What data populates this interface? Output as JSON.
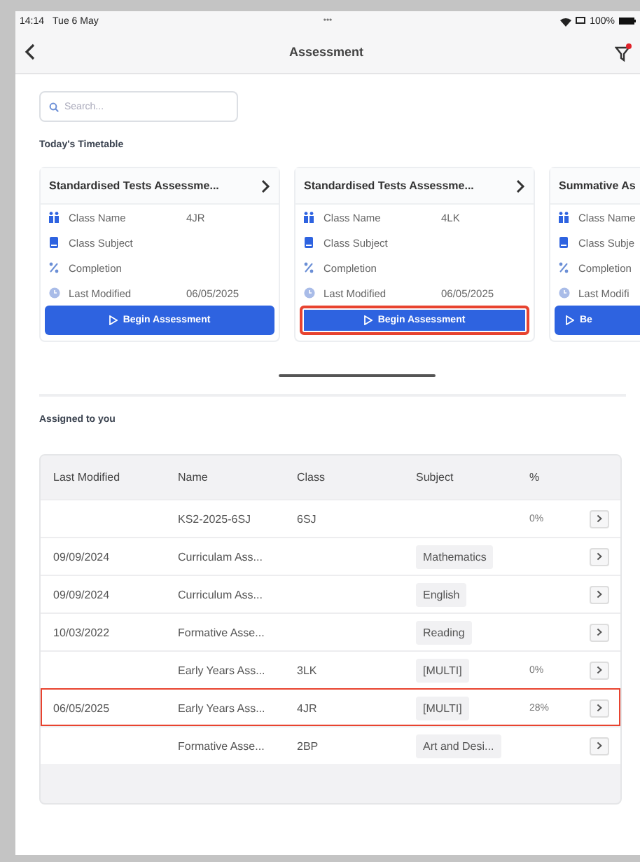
{
  "status_bar": {
    "time": "14:14",
    "date": "Tue 6 May",
    "dots": "•••",
    "battery": "100%"
  },
  "nav": {
    "title": "Assessment",
    "filter_badge": true
  },
  "search": {
    "placeholder": "Search..."
  },
  "timetable": {
    "heading": "Today's Timetable",
    "cards": [
      {
        "title": "Standardised Tests Assessme...",
        "fields": [
          {
            "kind": "class",
            "label": "Class Name",
            "value": "4JR"
          },
          {
            "kind": "subject",
            "label": "Class Subject"
          },
          {
            "kind": "completion",
            "label": "Completion"
          },
          {
            "kind": "modified",
            "label": "Last Modified",
            "value": "06/05/2025"
          }
        ],
        "button": "Begin Assessment",
        "highlighted": false
      },
      {
        "title": "Standardised Tests Assessme...",
        "fields": [
          {
            "kind": "class",
            "label": "Class Name",
            "value": "4LK"
          },
          {
            "kind": "subject",
            "label": "Class Subject"
          },
          {
            "kind": "completion",
            "label": "Completion"
          },
          {
            "kind": "modified",
            "label": "Last Modified",
            "value": "06/05/2025"
          }
        ],
        "button": "Begin Assessment",
        "highlighted": true
      },
      {
        "title": "Summative As",
        "fields": [
          {
            "kind": "class",
            "label": "Class Name"
          },
          {
            "kind": "subject",
            "label": "Class Subje"
          },
          {
            "kind": "completion",
            "label": "Completion"
          },
          {
            "kind": "modified",
            "label": "Last Modifi"
          }
        ],
        "button": "Be",
        "highlighted": false
      }
    ]
  },
  "assigned": {
    "heading": "Assigned to you",
    "columns": [
      "Last Modified",
      "Name",
      "Class",
      "Subject",
      "%"
    ],
    "rows": [
      {
        "name": "KS2-2025-6SJ",
        "class": "6SJ",
        "percent": "0%",
        "highlighted": false
      },
      {
        "last_modified": "09/09/2024",
        "name": "Curriculam Ass...",
        "subject": "Mathematics",
        "highlighted": false
      },
      {
        "last_modified": "09/09/2024",
        "name": "Curriculum Ass...",
        "subject": "English",
        "highlighted": false
      },
      {
        "last_modified": "10/03/2022",
        "name": "Formative Asse...",
        "subject": "Reading",
        "highlighted": false
      },
      {
        "name": "Early Years Ass...",
        "class": "3LK",
        "subject": "[MULTI]",
        "percent": "0%",
        "highlighted": false
      },
      {
        "last_modified": "06/05/2025",
        "name": "Early Years Ass...",
        "class": "4JR",
        "subject": "[MULTI]",
        "percent": "28%",
        "highlighted": true
      },
      {
        "name": "Formative Asse...",
        "class": "2BP",
        "subject": "Art and Desi...",
        "highlighted": false
      }
    ]
  }
}
